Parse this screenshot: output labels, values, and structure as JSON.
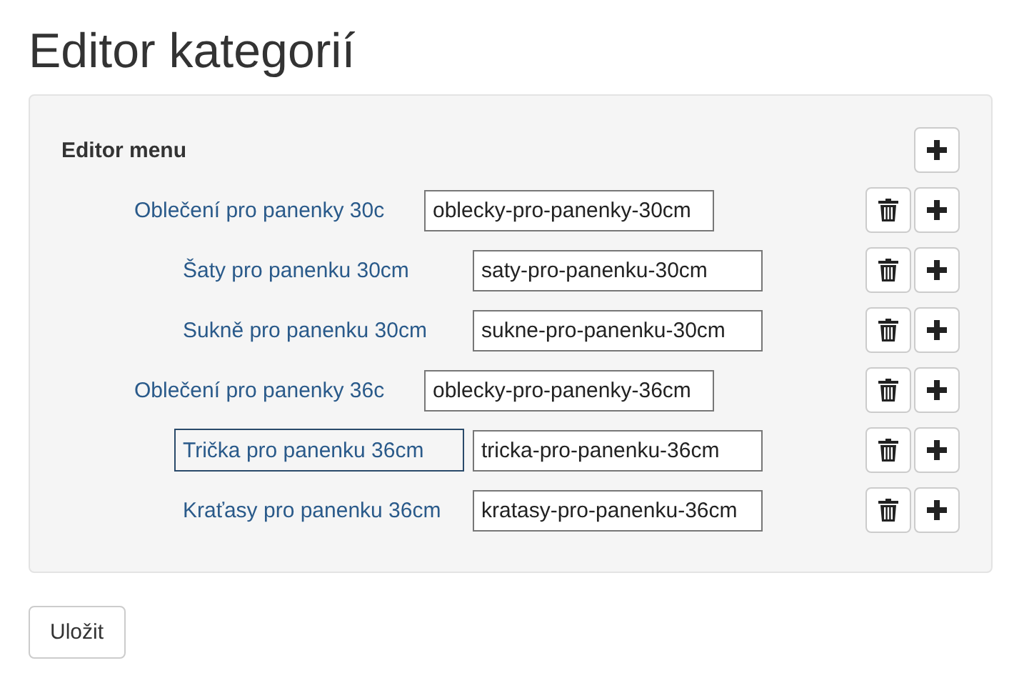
{
  "title": "Editor kategorií",
  "panel": {
    "heading": "Editor menu",
    "categories": [
      {
        "name": "Oblečení pro panenky 30c",
        "slug": "oblecky-pro-panenky-30cm",
        "focused": false,
        "children": [
          {
            "name": "Šaty pro panenku 30cm",
            "slug": "saty-pro-panenku-30cm",
            "focused": false
          },
          {
            "name": "Sukně pro panenku 30cm",
            "slug": "sukne-pro-panenku-30cm",
            "focused": false
          }
        ]
      },
      {
        "name": "Oblečení pro panenky 36c",
        "slug": "oblecky-pro-panenky-36cm",
        "focused": false,
        "children": [
          {
            "name": "Trička pro panenku 36cm",
            "slug": "tricka-pro-panenku-36cm",
            "focused": true
          },
          {
            "name": "Kraťasy pro panenku 36cm",
            "slug": "kratasy-pro-panenku-36cm",
            "focused": false
          }
        ]
      }
    ]
  },
  "save_button": "Uložit"
}
